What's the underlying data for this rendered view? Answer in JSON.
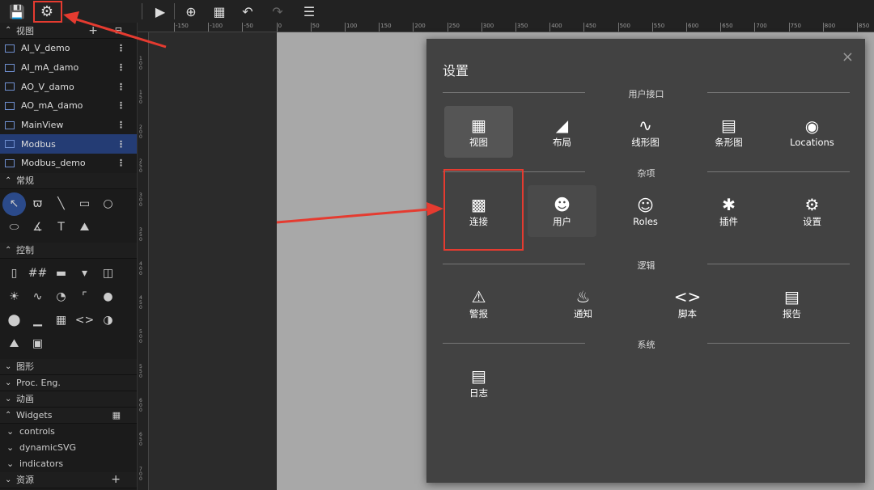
{
  "toolbar": {
    "buttons": [
      "save-icon",
      "settings-icon",
      "play-icon",
      "zoom-in-icon",
      "grid-icon",
      "undo-icon",
      "redo-icon",
      "list-icon"
    ]
  },
  "sidebar": {
    "views_label": "视图",
    "views": [
      {
        "label": "AI_V_demo"
      },
      {
        "label": "AI_mA_damo"
      },
      {
        "label": "AO_V_damo"
      },
      {
        "label": "AO_mA_damo"
      },
      {
        "label": "MainView"
      },
      {
        "label": "Modbus",
        "selected": true
      },
      {
        "label": "Modbus_demo"
      }
    ],
    "general_label": "常规",
    "controls_label": "控制",
    "shapes_label": "图形",
    "proc_label": "Proc. Eng.",
    "anim_label": "动画",
    "widgets_label": "Widgets",
    "widgets": [
      "controls",
      "dynamicSVG",
      "indicators"
    ],
    "resources_label": "资源"
  },
  "ruler": {
    "h": [
      "-150",
      "-100",
      "-50",
      "0",
      "50",
      "100",
      "150",
      "200",
      "250",
      "300",
      "350",
      "400",
      "450",
      "500",
      "550",
      "600",
      "650",
      "700",
      "750",
      "800",
      "850"
    ],
    "v": [
      "100",
      "150",
      "200",
      "250",
      "300",
      "350",
      "400",
      "450",
      "500",
      "550",
      "600",
      "650",
      "700"
    ]
  },
  "dialog": {
    "title": "设置",
    "close": "×",
    "sections": [
      {
        "label": "用户接口",
        "items": [
          {
            "label": "视图",
            "icon": "widgets-icon",
            "active": true
          },
          {
            "label": "布局",
            "icon": "layout-settings-icon"
          },
          {
            "label": "线形图",
            "icon": "line-chart-icon"
          },
          {
            "label": "条形图",
            "icon": "bar-chart-icon"
          },
          {
            "label": "Locations",
            "icon": "location-pin-icon"
          }
        ]
      },
      {
        "label": "杂项",
        "items": [
          {
            "label": "连接",
            "icon": "connection-icon",
            "highlighted": true
          },
          {
            "label": "用户",
            "icon": "users-icon"
          },
          {
            "label": "Roles",
            "icon": "roles-icon"
          },
          {
            "label": "插件",
            "icon": "plugin-icon"
          },
          {
            "label": "设置",
            "icon": "settings-icon"
          }
        ]
      },
      {
        "label": "逻辑",
        "items": [
          {
            "label": "警报",
            "icon": "warning-icon"
          },
          {
            "label": "通知",
            "icon": "bell-icon"
          },
          {
            "label": "脚本",
            "icon": "code-icon"
          },
          {
            "label": "报告",
            "icon": "clipboard-icon"
          }
        ]
      },
      {
        "label": "系统",
        "items": [
          {
            "label": "日志",
            "icon": "log-icon"
          }
        ]
      }
    ]
  },
  "annotation_color": "#e53b30"
}
